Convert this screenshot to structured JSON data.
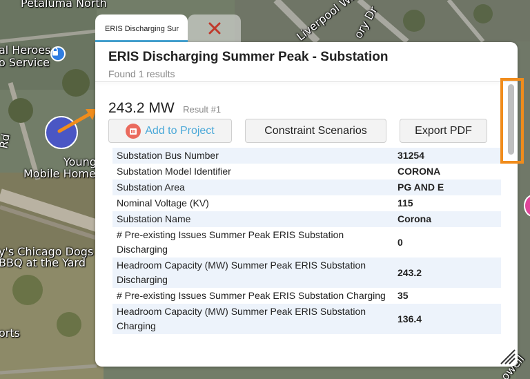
{
  "map": {
    "labels": [
      "Petaluma North",
      "al Heroes",
      "o Service",
      "Youngst",
      "Mobile Home",
      "y's Chicago Dogs",
      "BBQ at the Yard",
      "orts",
      "Rd",
      "Liverpool Way",
      "ory Dr",
      "owell"
    ]
  },
  "tabs": [
    {
      "label": "ERIS Discharging Sur",
      "active": true
    },
    {
      "label": "×",
      "icon": "close-icon"
    }
  ],
  "panel": {
    "title": "ERIS Discharging Summer Peak - Substation",
    "subtitle": "Found 1 results",
    "result": {
      "value": "243.2 MW",
      "number": "Result #1"
    },
    "buttons": {
      "add": "Add to Project",
      "constraint": "Constraint Scenarios",
      "export": "Export PDF"
    },
    "rows": [
      {
        "label": "Substation Bus Number",
        "value": "31254"
      },
      {
        "label": "Substation Model Identifier",
        "value": "CORONA"
      },
      {
        "label": "Substation Area",
        "value": "PG AND E"
      },
      {
        "label": "Nominal Voltage (KV)",
        "value": "115"
      },
      {
        "label": "Substation Name",
        "value": "Corona"
      },
      {
        "label": "# Pre-existing Issues Summer Peak ERIS Substation Discharging",
        "value": "0"
      },
      {
        "label": "Headroom Capacity (MW) Summer Peak ERIS Substation Discharging",
        "value": "243.2"
      },
      {
        "label": "# Pre-existing Issues Summer Peak ERIS Substation Charging",
        "value": "35"
      },
      {
        "label": "Headroom Capacity (MW) Summer Peak ERIS Substation Charging",
        "value": "136.4"
      }
    ]
  },
  "colors": {
    "accent": "#4aa8d8",
    "annotation": "#f08c1c",
    "marker": "#4a56c4"
  }
}
